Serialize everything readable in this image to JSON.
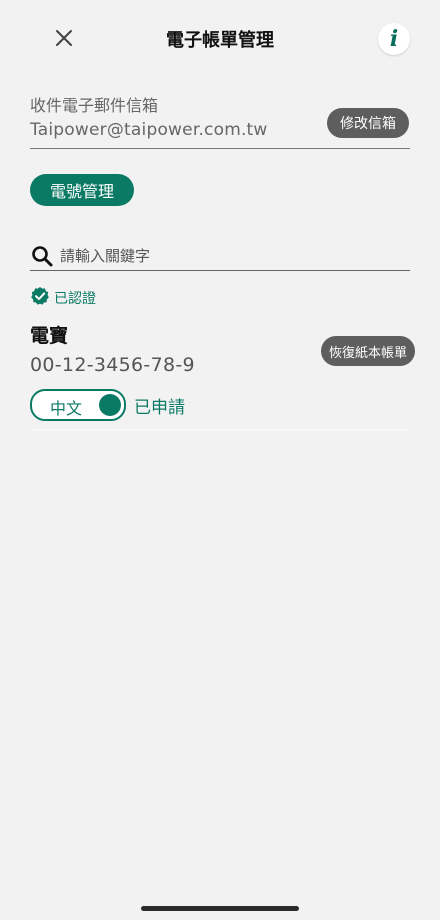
{
  "header": {
    "title": "電子帳單管理",
    "close_icon": "close-icon",
    "info_icon": "info-icon",
    "info_glyph": "i"
  },
  "email_section": {
    "label": "收件電子郵件信箱",
    "value": "Taipower@taipower.com.tw",
    "edit_button_label": "修改信箱"
  },
  "account_manage_button_label": "電號管理",
  "search": {
    "placeholder": "請輸入關鍵字",
    "value": "",
    "icon": "search-icon"
  },
  "verified": {
    "label": "已認證",
    "icon": "check-badge-icon"
  },
  "accounts": [
    {
      "name": "電寶",
      "number": "00-12-3456-78-9",
      "restore_button_label": "恢復紙本帳單",
      "language_toggle_label": "中文",
      "language_toggle_on": true,
      "status": "已申請"
    }
  ],
  "colors": {
    "accent": "#0b7a64",
    "gray_button": "#5e5e5e",
    "background": "#f2f2f2"
  }
}
